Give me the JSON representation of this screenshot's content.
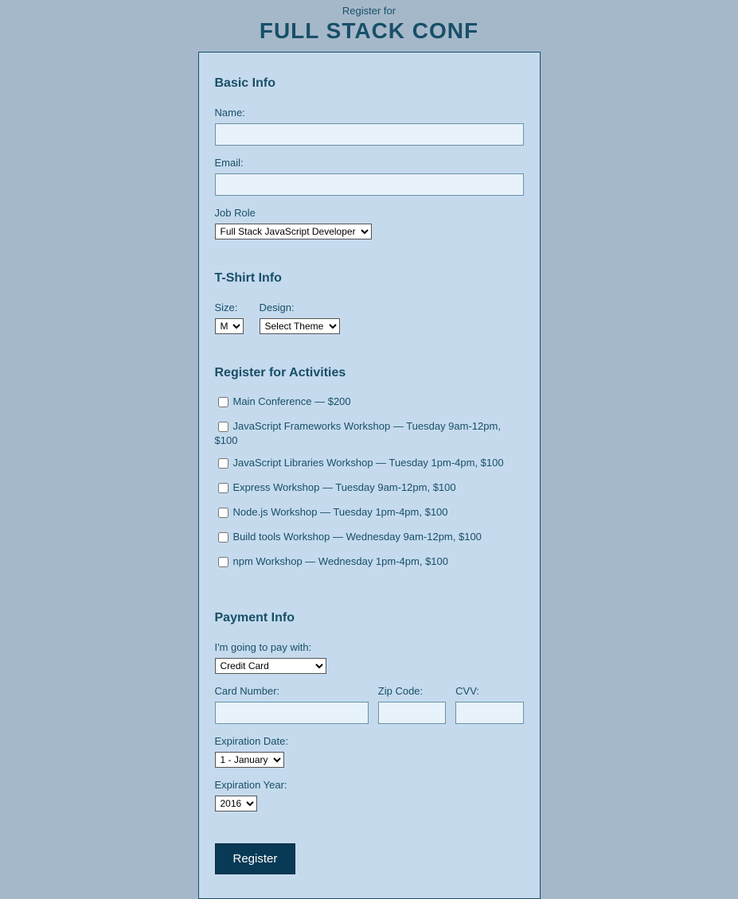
{
  "header": {
    "subtitle": "Register for",
    "title": "FULL STACK CONF"
  },
  "basic": {
    "legend": "Basic Info",
    "name_label": "Name:",
    "name_value": "",
    "email_label": "Email:",
    "email_value": "",
    "job_label": "Job Role",
    "job_selected": "Full Stack JavaScript Developer"
  },
  "tshirt": {
    "legend": "T-Shirt Info",
    "size_label": "Size:",
    "size_selected": "M",
    "design_label": "Design:",
    "design_selected": "Select Theme"
  },
  "activities": {
    "legend": "Register for Activities",
    "items": [
      "Main Conference — $200",
      "JavaScript Frameworks Workshop — Tuesday 9am-12pm, $100",
      "JavaScript Libraries Workshop — Tuesday 1pm-4pm, $100",
      "Express Workshop — Tuesday 9am-12pm, $100",
      "Node.js Workshop — Tuesday 1pm-4pm, $100",
      "Build tools Workshop — Wednesday 9am-12pm, $100",
      "npm Workshop — Wednesday 1pm-4pm, $100"
    ]
  },
  "payment": {
    "legend": "Payment Info",
    "pay_with_label": "I'm going to pay with:",
    "pay_with_selected": "Credit Card",
    "card_label": "Card Number:",
    "card_value": "",
    "zip_label": "Zip Code:",
    "zip_value": "",
    "cvv_label": "CVV:",
    "cvv_value": "",
    "exp_date_label": "Expiration Date:",
    "exp_date_selected": "1 - January",
    "exp_year_label": "Expiration Year:",
    "exp_year_selected": "2016"
  },
  "submit": {
    "label": "Register"
  }
}
